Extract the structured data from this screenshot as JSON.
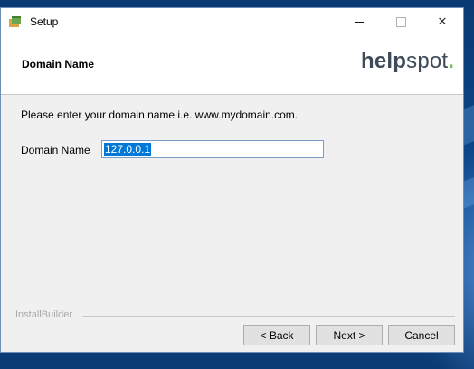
{
  "window": {
    "title": "Setup",
    "icon": "setup-app-icon"
  },
  "controls": {
    "minimize_icon": "minimize-icon",
    "maximize_icon": "maximize-icon",
    "close_glyph": "✕"
  },
  "header": {
    "title": "Domain Name",
    "logo": {
      "help": "help",
      "spot": "spot",
      "dot": "."
    }
  },
  "content": {
    "instruction": "Please enter your domain name i.e. www.mydomain.com.",
    "domain_label": "Domain Name",
    "domain_value": "127.0.0.1"
  },
  "footer": {
    "brand": "InstallBuilder",
    "back_label": "< Back",
    "next_label": "Next >",
    "cancel_label": "Cancel"
  },
  "colors": {
    "logo_text": "#3d4a5a",
    "logo_dot": "#6fbf5a",
    "selection": "#0078d7"
  }
}
